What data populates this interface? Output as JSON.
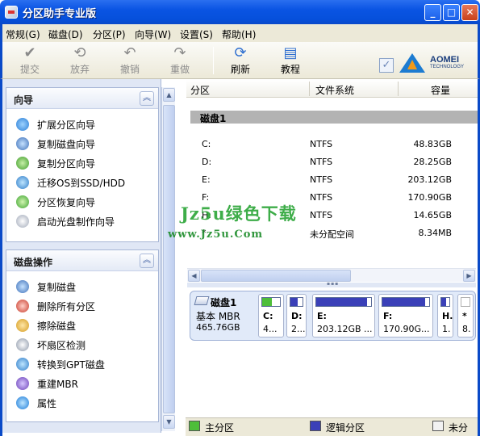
{
  "window": {
    "title": "分区助手专业版"
  },
  "menu": [
    "常规(G)",
    "磁盘(D)",
    "分区(P)",
    "向导(W)",
    "设置(S)",
    "帮助(H)"
  ],
  "toolbar": {
    "buttons": [
      {
        "label": "提交",
        "icon": "checkmark-icon"
      },
      {
        "label": "放弃",
        "icon": "discard-icon"
      },
      {
        "label": "撤销",
        "icon": "undo-icon"
      },
      {
        "label": "重做",
        "icon": "redo-icon"
      },
      {
        "label": "刷新",
        "icon": "refresh-icon"
      },
      {
        "label": "教程",
        "icon": "tutorial-icon"
      }
    ],
    "logo_text": "AOMEI",
    "logo_sub": "TECHNOLOGY"
  },
  "wizard_group": {
    "title": "向导",
    "items": [
      "扩展分区向导",
      "复制磁盘向导",
      "复制分区向导",
      "迁移OS到SSD/HDD",
      "分区恢复向导",
      "启动光盘制作向导"
    ]
  },
  "disk_ops_group": {
    "title": "磁盘操作",
    "items": [
      "复制磁盘",
      "删除所有分区",
      "擦除磁盘",
      "坏扇区检测",
      "转换到GPT磁盘",
      "重建MBR",
      "属性"
    ]
  },
  "partition_list": {
    "columns": [
      "分区",
      "文件系统",
      "容量"
    ],
    "disk_label": "磁盘1",
    "rows": [
      {
        "partition": "C:",
        "fs": "NTFS",
        "capacity": "48.83GB"
      },
      {
        "partition": "D:",
        "fs": "NTFS",
        "capacity": "28.25GB"
      },
      {
        "partition": "E:",
        "fs": "NTFS",
        "capacity": "203.12GB"
      },
      {
        "partition": "F:",
        "fs": "NTFS",
        "capacity": "170.90GB"
      },
      {
        "partition": "H:",
        "fs": "NTFS",
        "capacity": "14.65GB"
      },
      {
        "partition": "*",
        "fs": "未分配空间",
        "capacity": "8.34MB"
      }
    ]
  },
  "disk_map": {
    "name": "磁盘1",
    "type": "基本 MBR",
    "size": "465.76GB",
    "partitions": [
      {
        "label": "C:",
        "size": "4...",
        "used_fraction": 0.55,
        "color": "#4ebe3a"
      },
      {
        "label": "D:",
        "size": "2...",
        "used_fraction": 0.6,
        "color": "#3a40b8"
      },
      {
        "label": "E:",
        "size": "203.12GB ...",
        "used_fraction": 0.92,
        "color": "#3a40b8"
      },
      {
        "label": "F:",
        "size": "170.90G...",
        "used_fraction": 0.92,
        "color": "#3a40b8"
      },
      {
        "label": "H.",
        "size": "1.",
        "used_fraction": 0.6,
        "color": "#3a40b8"
      },
      {
        "label": "*",
        "size": "8.",
        "used_fraction": 0.0,
        "color": "#ffffff"
      }
    ]
  },
  "legend": [
    {
      "label": "主分区",
      "color": "#4ebe3a"
    },
    {
      "label": "逻辑分区",
      "color": "#3a40b8"
    },
    {
      "label": "未分",
      "color": "#f2f2f2"
    }
  ],
  "watermark": {
    "main": "Jz5u绿色下载",
    "url": "www.Jz5u.Com"
  }
}
